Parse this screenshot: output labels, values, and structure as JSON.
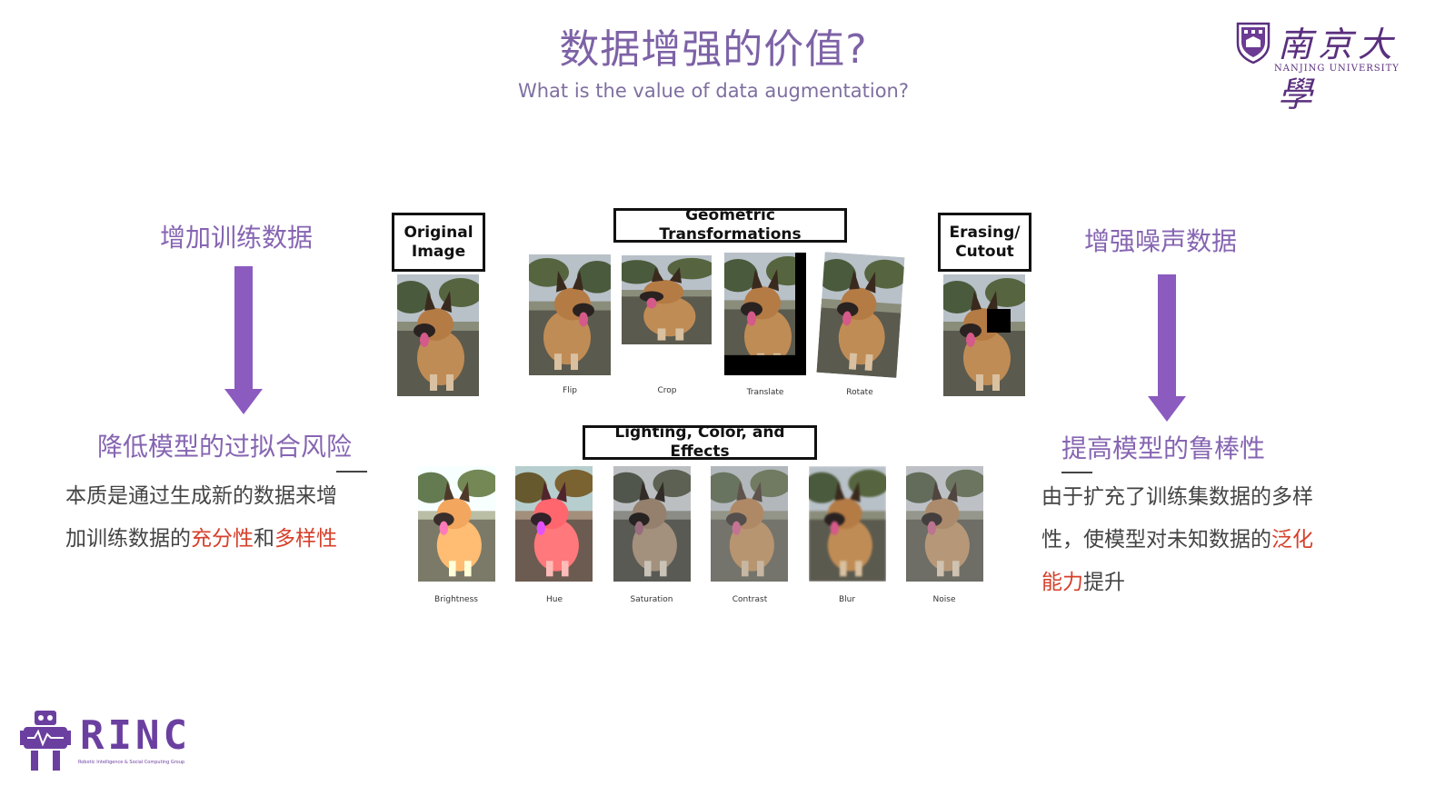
{
  "header": {
    "title_cn": "数据增强的价值?",
    "title_en": "What is the value of data augmentation?"
  },
  "logo": {
    "name_cn": "南京大學",
    "name_en": "NANJING UNIVERSITY"
  },
  "left": {
    "top_label": "增加训练数据",
    "result_label": "降低模型的过拟合风险",
    "body_line1": "本质是通过生成新的数据来增",
    "body_line2_a": "加训练数据的",
    "body_line2_b": "充分性",
    "body_line2_c": "和",
    "body_line2_d": "多样性"
  },
  "right": {
    "top_label": "增强噪声数据",
    "result_label": "提高模型的鲁棒性",
    "body_line1": "由于扩充了训练集数据的多样",
    "body_line2_a": "性，使模型对未知数据的",
    "body_line2_b": "泛化",
    "body_line3_a": "能力",
    "body_line3_b": "提升"
  },
  "figure": {
    "original_label": "Original Image",
    "geometric_label": "Geometric Transformations",
    "erasing_label": "Erasing/ Cutout",
    "lighting_label": "Lighting, Color, and Effects",
    "geometric_captions": [
      "Flip",
      "Crop",
      "Translate",
      "Rotate"
    ],
    "lighting_captions": [
      "Brightness",
      "Hue",
      "Saturation",
      "Contrast",
      "Blur",
      "Noise"
    ]
  },
  "footer": {
    "lab_name": "RINC",
    "lab_subtitle": "Robotic Intelligence & Social Computing Group"
  },
  "colors": {
    "accent_purple": "#8b5bbf",
    "title_purple": "#7d62a6",
    "highlight_red": "#d6402b"
  }
}
